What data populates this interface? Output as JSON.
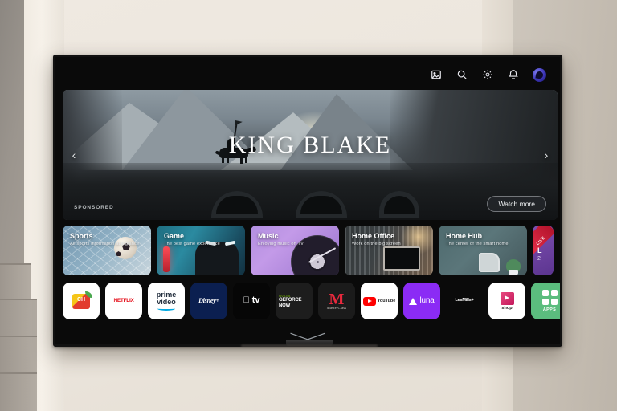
{
  "scene": {
    "description": "Wall-mounted smart TV displaying a TV home launcher screen in a living room"
  },
  "topbar": {
    "icons": [
      {
        "name": "media-picture-icon",
        "glyph": "picture"
      },
      {
        "name": "search-icon",
        "glyph": "magnifier"
      },
      {
        "name": "settings-gear-icon",
        "glyph": "gear"
      },
      {
        "name": "notification-bell-icon",
        "glyph": "bell"
      }
    ],
    "avatar_label": "Profile"
  },
  "hero": {
    "title": "KING BLAKE",
    "sponsored_label": "SPONSORED",
    "watch_more_label": "Watch more",
    "prev_arrow": "‹",
    "next_arrow": "›"
  },
  "categories": [
    {
      "title": "Sports",
      "subtitle": "All sports information at a glance"
    },
    {
      "title": "Game",
      "subtitle": "The best game experience"
    },
    {
      "title": "Music",
      "subtitle": "Enjoying music on TV"
    },
    {
      "title": "Home Office",
      "subtitle": "Work on the big screen"
    },
    {
      "title": "Home Hub",
      "subtitle": "The center of the smart home"
    },
    {
      "title": "L",
      "subtitle": "2",
      "badge": "LIVE"
    }
  ],
  "apps": [
    {
      "name": "channels",
      "label": "CH"
    },
    {
      "name": "netflix",
      "label": "NETFLIX"
    },
    {
      "name": "prime-video",
      "label_top": "prime",
      "label_bottom": "video"
    },
    {
      "name": "disney-plus",
      "label": "Disney+"
    },
    {
      "name": "apple-tv",
      "label": " tv"
    },
    {
      "name": "geforce-now",
      "label_top": "NVIDIA",
      "label": "GEFORCE NOW"
    },
    {
      "name": "masterclass",
      "label_top": "M",
      "label": "MasterClass"
    },
    {
      "name": "youtube",
      "label": "YouTube"
    },
    {
      "name": "luna",
      "label": "luna"
    },
    {
      "name": "lesmills-plus",
      "label": "LesMills+"
    },
    {
      "name": "shop",
      "label": "shop"
    },
    {
      "name": "apps",
      "label": "APPS"
    },
    {
      "name": "screen-share",
      "label": ""
    },
    {
      "name": "more-app",
      "label": ""
    }
  ],
  "colors": {
    "accent_purple": "#8b2bf5",
    "netflix_red": "#e50914",
    "apps_green": "#5bbd7e",
    "live_red": "#e8304a",
    "cast_teal": "#3d8ca3"
  }
}
